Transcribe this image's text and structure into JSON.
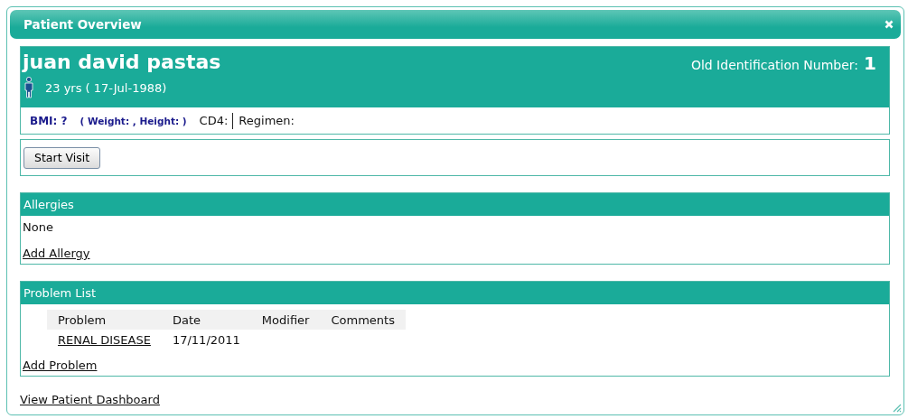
{
  "window": {
    "title": "Patient Overview"
  },
  "patient": {
    "name": "juan david pastas",
    "age": "23 yrs ( 17-Jul-1988)",
    "id_label": "Old Identification Number:",
    "id_value": "1"
  },
  "vitals": {
    "bmi": "BMI: ?",
    "weight_height": "( Weight: , Height: )",
    "cd4": "CD4:",
    "regimen": "Regimen:"
  },
  "actions": [
    "Start Visit"
  ],
  "allergies": {
    "title": "Allergies",
    "items": [
      "None"
    ],
    "add_link": "Add Allergy"
  },
  "problems": {
    "title": "Problem List",
    "columns": [
      "Problem",
      "Date",
      "Modifier",
      "Comments"
    ],
    "rows": [
      [
        "RENAL DISEASE",
        "17/11/2011"
      ]
    ],
    "add_link": "Add Problem"
  },
  "footer_link": "View Patient Dashboard"
}
